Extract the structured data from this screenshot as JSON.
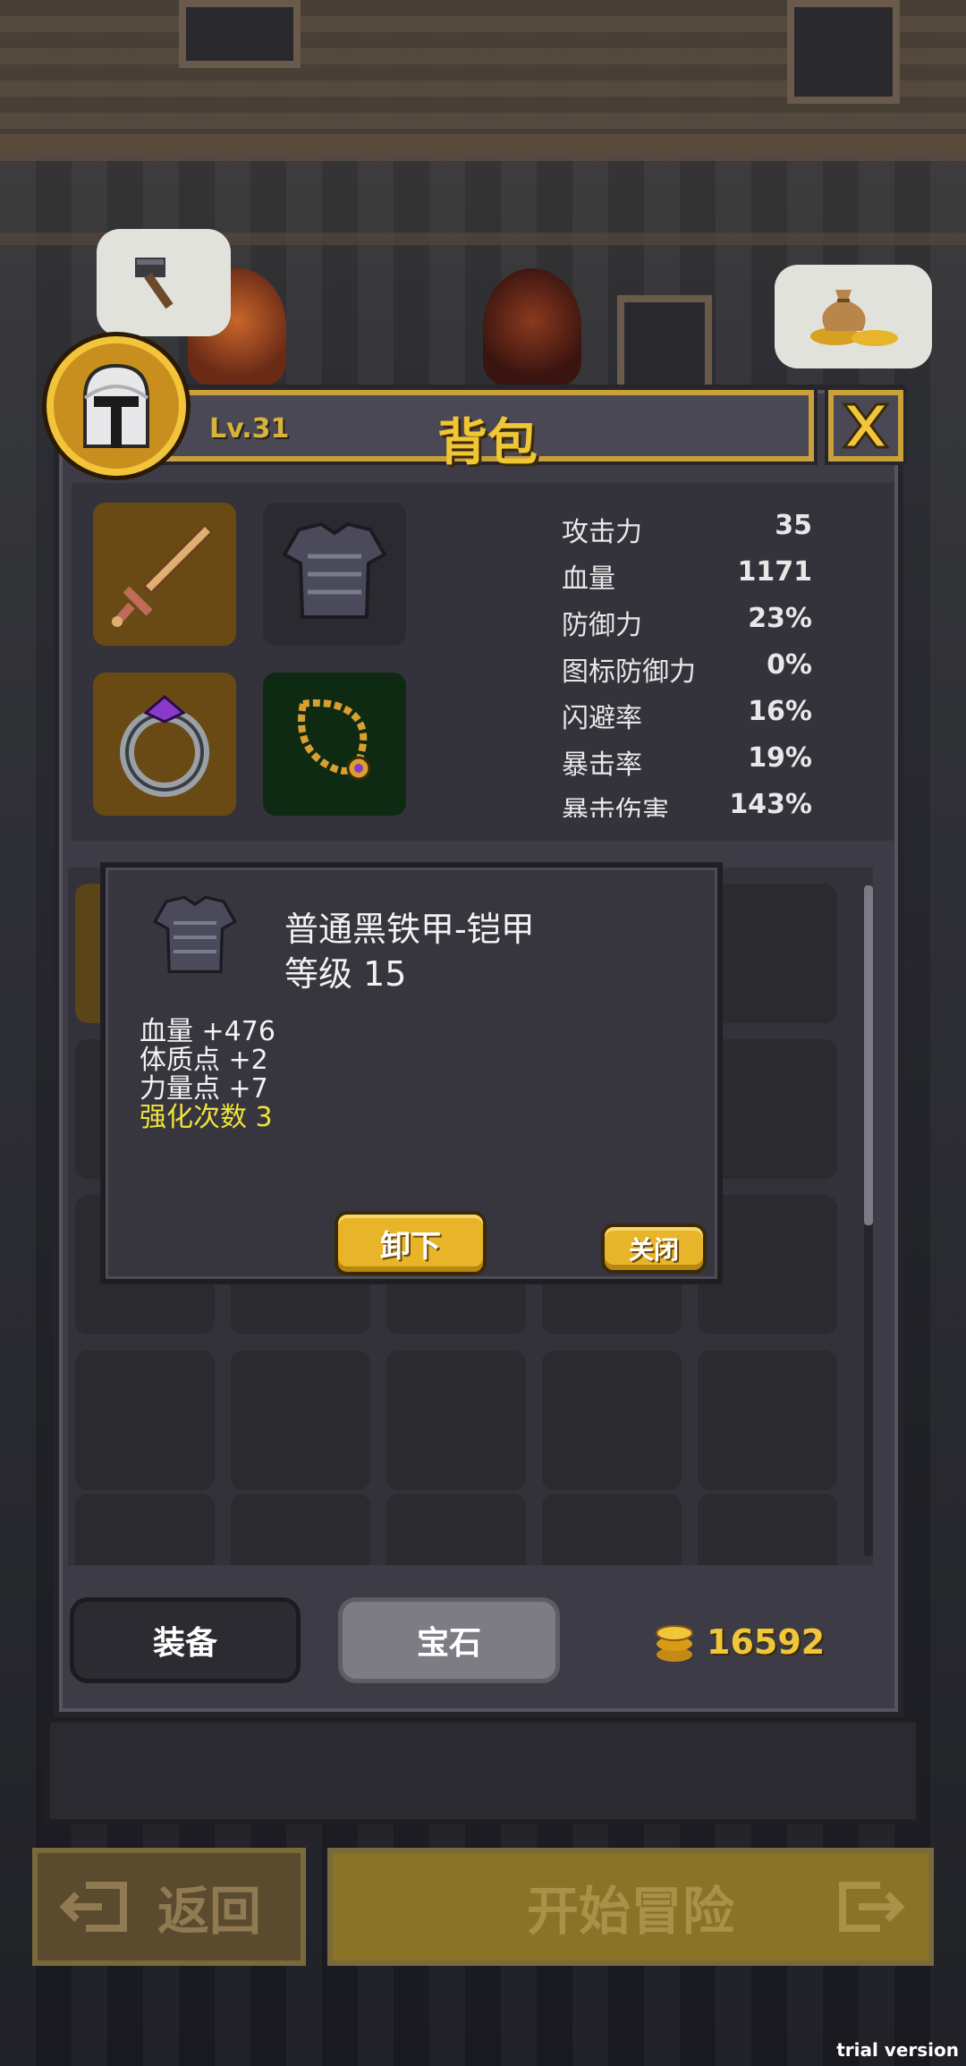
{
  "panel": {
    "title": "背包",
    "level": "Lv.31",
    "close_icon": "close-x-icon"
  },
  "equipped": [
    {
      "slot": "weapon",
      "icon": "sword-icon"
    },
    {
      "slot": "armor",
      "icon": "chestplate-icon"
    },
    {
      "slot": "ring",
      "icon": "ring-icon"
    },
    {
      "slot": "necklace",
      "icon": "necklace-icon"
    }
  ],
  "stats": [
    {
      "label": "攻击力",
      "value": "35"
    },
    {
      "label": "血量",
      "value": "1171"
    },
    {
      "label": "防御力",
      "value": "23%"
    },
    {
      "label": "图标防御力",
      "value": "0%"
    },
    {
      "label": "闪避率",
      "value": "16%"
    },
    {
      "label": "暴击率",
      "value": "19%"
    },
    {
      "label": "暴击伤害",
      "value": "143%"
    }
  ],
  "popup": {
    "item_name": "普通黑铁甲-铠甲",
    "level_text": "等级 15",
    "attributes": [
      {
        "text": "血量 +476",
        "highlight": false
      },
      {
        "text": "体质点 +2",
        "highlight": false
      },
      {
        "text": "力量点 +7",
        "highlight": false
      },
      {
        "text": "强化次数 3",
        "highlight": true
      }
    ],
    "unequip_label": "卸下",
    "close_label": "关闭"
  },
  "tabs": {
    "equipment": "装备",
    "gems": "宝石"
  },
  "gold": "16592",
  "bottom": {
    "back_label": "返回",
    "start_label": "开始冒险"
  },
  "watermark": "trial version",
  "colors": {
    "accent_gold": "#e8b52a",
    "panel": "#3d3c46",
    "highlight_text": "#f0e23a"
  }
}
